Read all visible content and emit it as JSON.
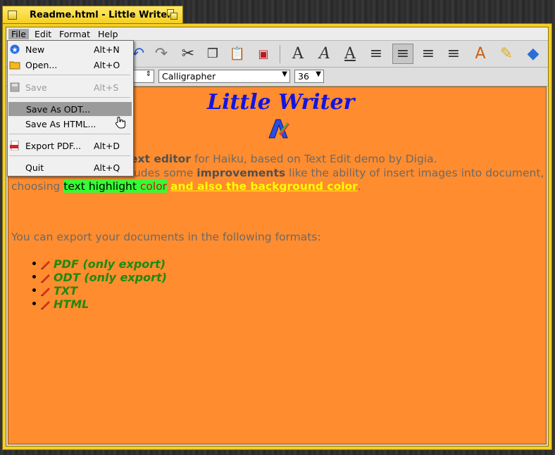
{
  "window": {
    "title": "Readme.html - Little Writer"
  },
  "menubar": {
    "items": [
      "File",
      "Edit",
      "Format",
      "Help"
    ]
  },
  "file_menu": {
    "items": [
      {
        "label": "New",
        "shortcut": "Alt+N",
        "icon": "new-icon"
      },
      {
        "label": "Open...",
        "shortcut": "Alt+O",
        "icon": "folder-icon"
      },
      {
        "label": "Save",
        "shortcut": "Alt+S",
        "icon": "save-icon",
        "disabled": true
      },
      {
        "label": "Save As ODT...",
        "shortcut": "",
        "highlighted": true
      },
      {
        "label": "Save As HTML...",
        "shortcut": ""
      },
      {
        "label": "Export PDF...",
        "shortcut": "Alt+D",
        "icon": "pdf-icon"
      },
      {
        "label": "Quit",
        "shortcut": "Alt+Q"
      }
    ]
  },
  "fontbar": {
    "font": "Calligrapher",
    "size": "36"
  },
  "document": {
    "heading": "Little Writer",
    "line1_bold": "ext editor",
    "line1_rest": " for Haiku, based on Text Edit demo by Digia.",
    "line2_pre": "This Haiku version includes some ",
    "line2_bold": "improvements",
    "line2_rest": " like the ability of insert images into document,",
    "line3_pre": "choosing ",
    "hl_text": "text highlight ",
    "hl_red": "color",
    "yellow_text": "and also the background color",
    "line3_end": ".",
    "export_line": "You can export your documents in the following formats:",
    "formats": [
      "PDF (only export)",
      "ODT (only export)",
      "TXT",
      "HTML"
    ]
  },
  "colors": {
    "doc_background": "#ff8c2e",
    "heading": "#1414e0",
    "list_text": "#1e8a10",
    "window_tab": "#f5cf1e"
  }
}
